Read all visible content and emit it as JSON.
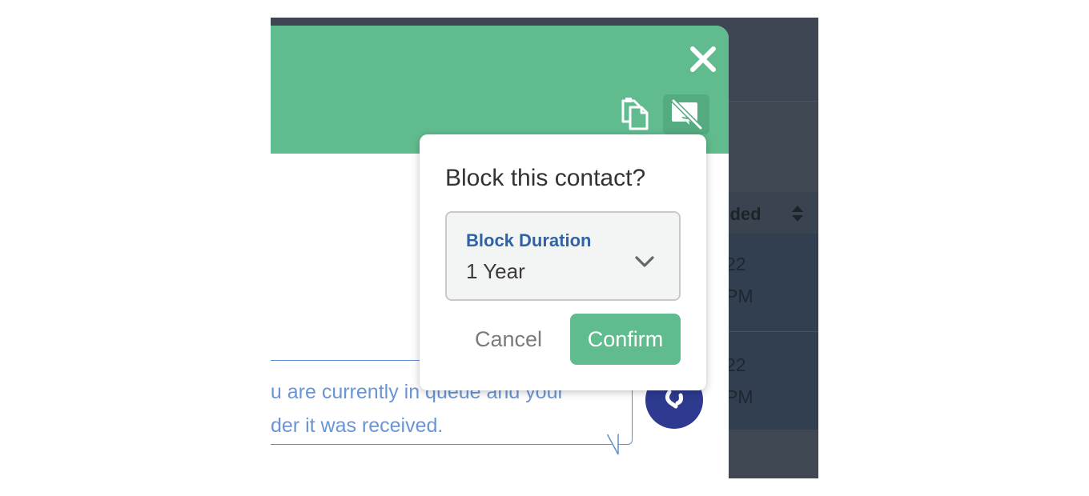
{
  "background_table": {
    "header_partial": "nded",
    "rows": [
      {
        "line1": "22",
        "line2": "PM"
      },
      {
        "line1": "22",
        "line2": "PM"
      }
    ]
  },
  "chat_panel": {
    "message_line1": "ou are currently in queue and your",
    "message_line2": "der it was received.",
    "icons": {
      "close": "close-icon",
      "copy": "clipboard-copy-icon",
      "block": "block-contact-icon",
      "avatar": "chat-avatar-icon"
    }
  },
  "block_popover": {
    "title": "Block this contact?",
    "duration_label": "Block Duration",
    "duration_value": "1 Year",
    "cancel_label": "Cancel",
    "confirm_label": "Confirm"
  },
  "colors": {
    "header_green": "#60bc8e",
    "confirm_green": "#60bc8e",
    "label_blue": "#2f63a6",
    "message_blue": "#6a95d4",
    "overlay_dark": "#3f4853"
  }
}
